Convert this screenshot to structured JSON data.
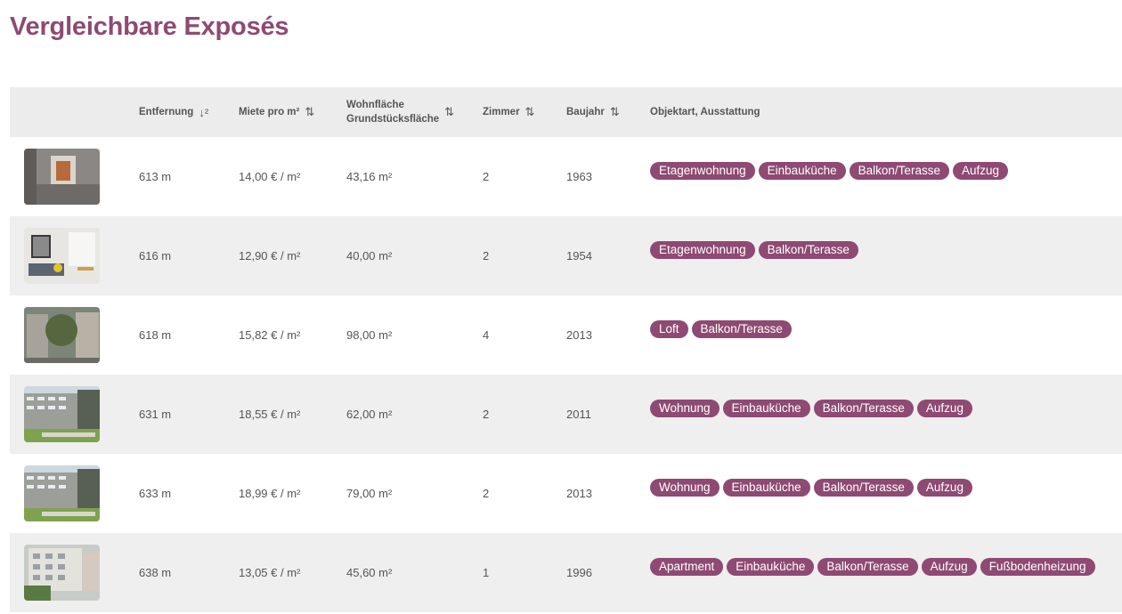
{
  "title": "Vergleichbare Exposés",
  "columns": [
    {
      "key": "entfernung",
      "label": "Entfernung",
      "sort_icon": "↓²"
    },
    {
      "key": "miete",
      "label": "Miete pro m²",
      "sort_icon": "⇅"
    },
    {
      "key": "wohnflaeche",
      "label_line1": "Wohnfläche",
      "label_line2": "Grundstücksfläche",
      "sort_icon": "⇅"
    },
    {
      "key": "zimmer",
      "label": "Zimmer",
      "sort_icon": "⇅"
    },
    {
      "key": "baujahr",
      "label": "Baujahr",
      "sort_icon": "⇅"
    },
    {
      "key": "objektart",
      "label": "Objektart, Ausstattung"
    }
  ],
  "rows": [
    {
      "entfernung": "613 m",
      "miete": "14,00 € / m²",
      "flaeche": "43,16 m²",
      "zimmer": "2",
      "baujahr": "1963",
      "thumb": "interior-room-photo",
      "tags": [
        "Etagenwohnung",
        "Einbauküche",
        "Balkon/Terasse",
        "Aufzug"
      ]
    },
    {
      "entfernung": "616 m",
      "miete": "12,90 € / m²",
      "flaeche": "40,00 m²",
      "zimmer": "2",
      "baujahr": "1954",
      "thumb": "living-room-photo",
      "tags": [
        "Etagenwohnung",
        "Balkon/Terasse"
      ]
    },
    {
      "entfernung": "618 m",
      "miete": "15,82 € / m²",
      "flaeche": "98,00 m²",
      "zimmer": "4",
      "baujahr": "2013",
      "thumb": "building-facade-photo",
      "tags": [
        "Loft",
        "Balkon/Terasse"
      ]
    },
    {
      "entfernung": "631 m",
      "miete": "18,55 € / m²",
      "flaeche": "62,00 m²",
      "zimmer": "2",
      "baujahr": "2011",
      "thumb": "apartment-complex-photo",
      "tags": [
        "Wohnung",
        "Einbauküche",
        "Balkon/Terasse",
        "Aufzug"
      ]
    },
    {
      "entfernung": "633 m",
      "miete": "18,99 € / m²",
      "flaeche": "79,00 m²",
      "zimmer": "2",
      "baujahr": "2013",
      "thumb": "apartment-complex-photo",
      "tags": [
        "Wohnung",
        "Einbauküche",
        "Balkon/Terasse",
        "Aufzug"
      ]
    },
    {
      "entfernung": "638 m",
      "miete": "13,05 € / m²",
      "flaeche": "45,60 m²",
      "zimmer": "1",
      "baujahr": "1996",
      "thumb": "white-building-photo",
      "tags": [
        "Apartment",
        "Einbauküche",
        "Balkon/Terasse",
        "Aufzug",
        "Fußbodenheizung"
      ]
    }
  ],
  "colors": {
    "accent": "#8e4a72",
    "header_bg": "#ececec",
    "row_alt_bg": "#efefef"
  }
}
